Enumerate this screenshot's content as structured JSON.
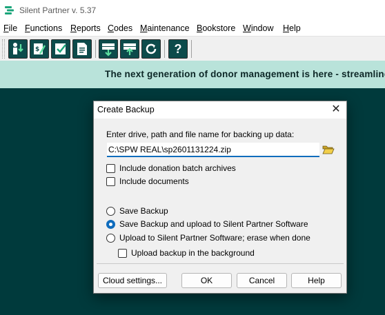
{
  "app": {
    "title": "Silent Partner v. 5.37"
  },
  "menu": {
    "items": [
      {
        "first": "F",
        "rest": "ile"
      },
      {
        "first": "F",
        "rest": "unctions"
      },
      {
        "first": "R",
        "rest": "eports"
      },
      {
        "first": "C",
        "rest": "odes"
      },
      {
        "first": "M",
        "rest": "aintenance"
      },
      {
        "first": "B",
        "rest": "ookstore"
      },
      {
        "first": "W",
        "rest": "indow"
      },
      {
        "first": "H",
        "rest": "elp"
      }
    ]
  },
  "toolbar": {
    "buttons": [
      {
        "icon": "donor-icon"
      },
      {
        "icon": "donation-entry-icon"
      },
      {
        "icon": "batch-checklist-icon"
      },
      {
        "icon": "receipt-document-icon"
      },
      {
        "icon": "download-data-icon"
      },
      {
        "icon": "upload-data-icon"
      },
      {
        "icon": "refresh-icon"
      },
      {
        "icon": "help-icon",
        "glyph": "?"
      }
    ]
  },
  "banner": {
    "text": "The next generation of donor management is here - streamline"
  },
  "dialog": {
    "title": "Create Backup",
    "close_glyph": "✕",
    "prompt": "Enter drive, path and file name for backing up data:",
    "path_value": "C:\\SPW REAL\\sp2601131224.zip",
    "checkboxes": {
      "include_batch_archives": {
        "label": "Include donation batch archives",
        "checked": false
      },
      "include_documents": {
        "label": "Include documents",
        "checked": false
      },
      "background_upload": {
        "label": "Upload backup in the background",
        "checked": false
      }
    },
    "radios": {
      "save": {
        "label": "Save Backup",
        "selected": false
      },
      "save_upload": {
        "label": "Save Backup and upload to Silent Partner Software",
        "selected": true
      },
      "upload_erase": {
        "label": "Upload to Silent Partner Software; erase when done",
        "selected": false
      }
    },
    "buttons": {
      "cloud_settings": "Cloud settings...",
      "ok": "OK",
      "cancel": "Cancel",
      "help": "Help"
    }
  },
  "colors": {
    "workspace": "#003a3c",
    "banner": "#b9e3da",
    "toolbar_icon": "#0d4b4b",
    "accent": "#0f6cbd"
  }
}
